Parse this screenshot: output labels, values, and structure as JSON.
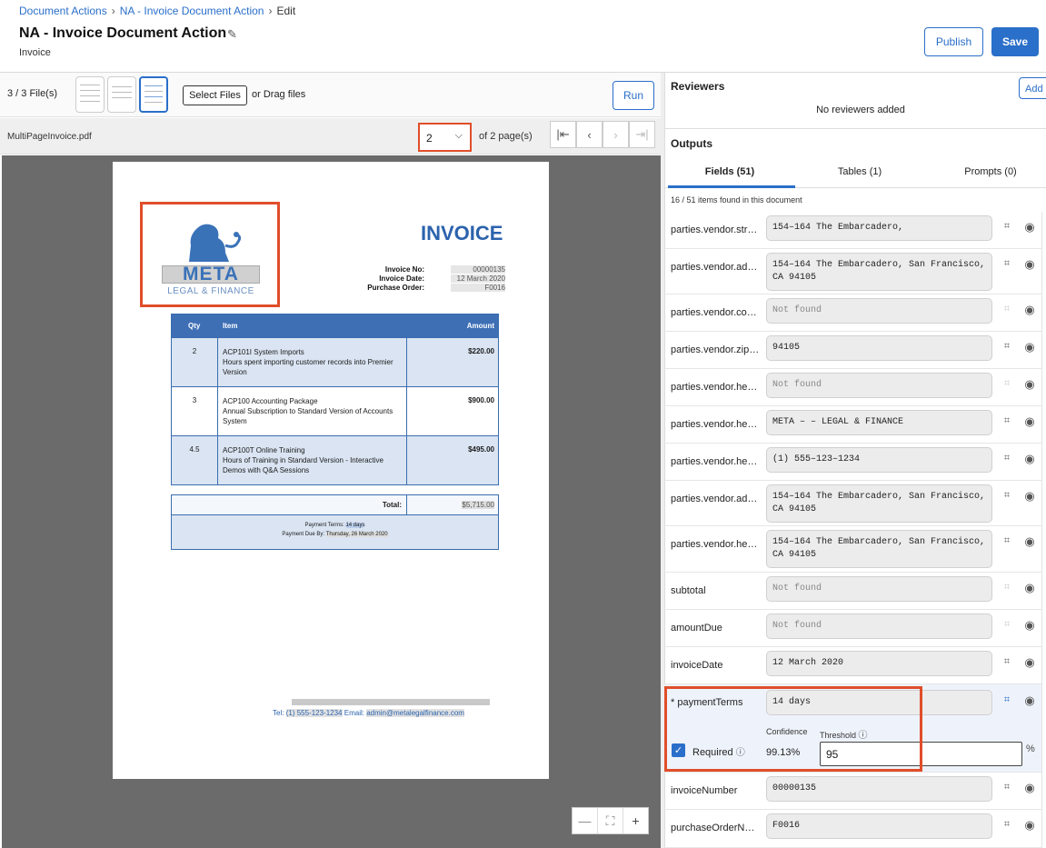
{
  "breadcrumb": [
    "Document Actions",
    "NA - Invoice Document Action",
    "Edit"
  ],
  "page": {
    "title": "NA - Invoice Document Action",
    "subtitle": "Invoice"
  },
  "header_buttons": {
    "publish": "Publish",
    "save": "Save"
  },
  "files": {
    "count_label": "3 / 3 File(s)",
    "select_label": "Select Files",
    "drag_label": "or Drag files",
    "run_label": "Run"
  },
  "pager": {
    "file_name": "MultiPageInvoice.pdf",
    "current_page": "2",
    "of_label": "of 2 page(s)"
  },
  "document": {
    "logo_text": "META",
    "logo_sub": "LEGAL & FINANCE",
    "title": "INVOICE",
    "meta_labels": [
      "Invoice No:",
      "Invoice Date:",
      "Purchase Order:"
    ],
    "meta_values": [
      "00000135",
      "12 March 2020",
      "F0016"
    ],
    "table_headers": {
      "qty": "Qty",
      "item": "Item",
      "amount": "Amount"
    },
    "rows": [
      {
        "qty": "2",
        "title": "ACP101I System Imports",
        "desc": "Hours spent importing customer records into Premier Version",
        "amount": "$220.00"
      },
      {
        "qty": "3",
        "title": "ACP100 Accounting Package",
        "desc": "Annual Subscription to Standard Version of Accounts System",
        "amount": "$900.00"
      },
      {
        "qty": "4.5",
        "title": "ACP100T Online Training",
        "desc": "Hours of Training in Standard Version - Interactive Demos with Q&A Sessions",
        "amount": "$495.00"
      }
    ],
    "total_label": "Total:",
    "total_value": "$5,715.00",
    "payment_terms_label": "Payment Terms:",
    "payment_terms_value": "14 days",
    "payment_due_label": "Payment Due By:",
    "payment_due_value": "Thursday, 26 March 2020",
    "tel_label": "Tel:",
    "tel_value": "(1) 555-123-1234",
    "email_label": "Email:",
    "email_value": "admin@metalegalfinance.com"
  },
  "reviewers": {
    "title": "Reviewers",
    "add_label": "Add",
    "empty_text": "No reviewers added"
  },
  "outputs": {
    "title": "Outputs",
    "tabs": [
      "Fields (51)",
      "Tables (1)",
      "Prompts (0)"
    ],
    "found_text": "16 / 51 items found in this document",
    "fields": [
      {
        "name": "parties.vendor.str…",
        "value": "154–164 The Embarcadero,"
      },
      {
        "name": "parties.vendor.ad…",
        "value": "154–164 The Embarcadero, San Francisco,\nCA 94105"
      },
      {
        "name": "parties.vendor.co…",
        "value": "Not found"
      },
      {
        "name": "parties.vendor.zip…",
        "value": "94105"
      },
      {
        "name": "parties.vendor.he…",
        "value": "Not found"
      },
      {
        "name": "parties.vendor.he…",
        "value": "META – – LEGAL & FINANCE"
      },
      {
        "name": "parties.vendor.he…",
        "value": "(1) 555–123–1234"
      },
      {
        "name": "parties.vendor.ad…",
        "value": "154–164 The Embarcadero, San Francisco,\nCA 94105"
      },
      {
        "name": "parties.vendor.he…",
        "value": "154–164 The Embarcadero, San Francisco,\nCA 94105"
      },
      {
        "name": "subtotal",
        "value": "Not found"
      },
      {
        "name": "amountDue",
        "value": "Not found"
      },
      {
        "name": "invoiceDate",
        "value": "12 March 2020"
      },
      {
        "name": "* paymentTerms",
        "value": "14 days"
      },
      {
        "name": "invoiceNumber",
        "value": "00000135"
      },
      {
        "name": "purchaseOrderN…",
        "value": "F0016"
      }
    ],
    "payment_terms_detail": {
      "confidence_label": "Confidence",
      "threshold_label": "Threshold",
      "required_label": "Required",
      "confidence_value": "99.13%",
      "threshold_value": "95",
      "unit": "%"
    }
  },
  "icons": {
    "edit": "pencil-icon",
    "scan": "scan-icon",
    "view": "eye-icon",
    "info": "info-icon",
    "check": "check-icon"
  },
  "colors": {
    "accent": "#2a6fc9",
    "highlight": "#e04e2a",
    "invoice_blue": "#2b63ad"
  }
}
